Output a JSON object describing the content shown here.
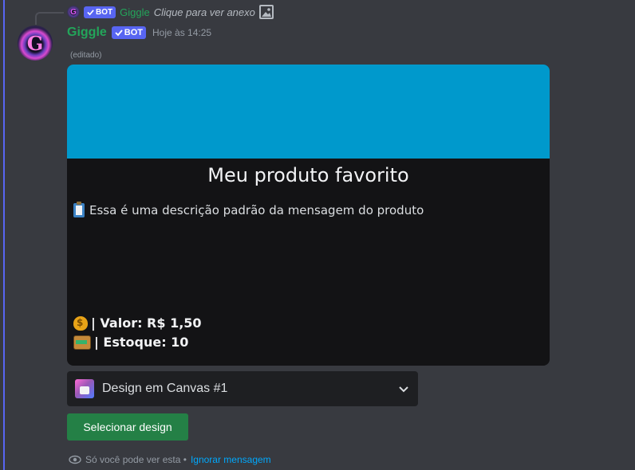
{
  "reply": {
    "author": "Giggle",
    "bot_tag": "BOT",
    "preview": "Clique para ver anexo",
    "attachment_icon": "image-icon"
  },
  "message": {
    "author": "Giggle",
    "bot_tag": "BOT",
    "timestamp": "Hoje às 14:25",
    "edited": "(editado)",
    "avatar_initial": "G"
  },
  "card": {
    "banner_color": "#0099cc",
    "title": "Meu produto favorito",
    "description": "Essa é uma descrição padrão da mensagem do produto",
    "value_line": "| Valor: R$ 1,50",
    "stock_line": "| Estoque: 10"
  },
  "select": {
    "value": "Design em Canvas #1"
  },
  "button": {
    "label": "Selecionar design",
    "color": "#248046"
  },
  "footer": {
    "notice": "Só você pode ver esta •",
    "dismiss": "Ignorar mensagem"
  }
}
